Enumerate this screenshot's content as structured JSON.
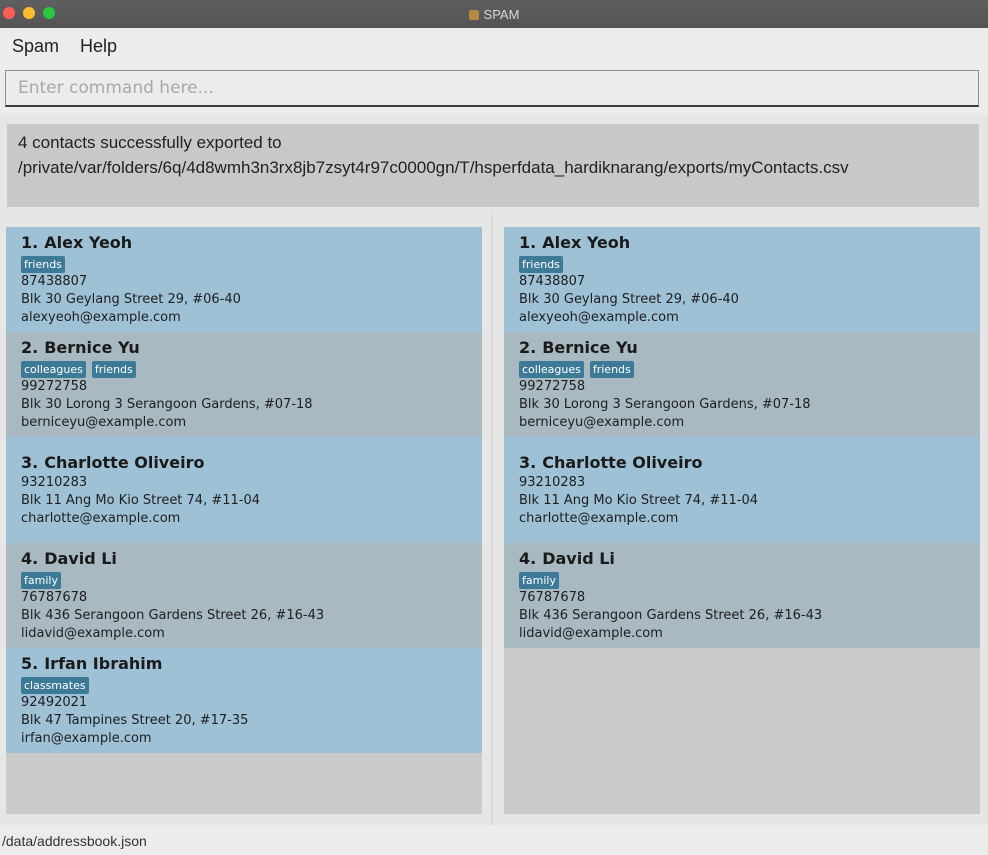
{
  "window": {
    "title": "SPAM"
  },
  "menu": {
    "spam": "Spam",
    "help": "Help"
  },
  "command": {
    "placeholder": "Enter command here...",
    "value": ""
  },
  "result": {
    "line1": "4 contacts successfully exported to",
    "line2": "/private/var/folders/6q/4d8wmh3n3rx8jb7zsyt4r97c0000gn/T/hsperfdata_hardiknarang/exports/myContacts.csv"
  },
  "left_list": [
    {
      "index": "1.",
      "name": "Alex Yeoh",
      "tags": [
        "friends"
      ],
      "phone": "87438807",
      "address": "Blk 30 Geylang Street 29, #06-40",
      "email": "alexyeoh@example.com"
    },
    {
      "index": "2.",
      "name": "Bernice Yu",
      "tags": [
        "colleagues",
        "friends"
      ],
      "phone": "99272758",
      "address": "Blk 30 Lorong 3 Serangoon Gardens, #07-18",
      "email": "berniceyu@example.com"
    },
    {
      "index": "3.",
      "name": "Charlotte Oliveiro",
      "tags": [],
      "phone": "93210283",
      "address": "Blk 11 Ang Mo Kio Street 74, #11-04",
      "email": "charlotte@example.com"
    },
    {
      "index": "4.",
      "name": "David Li",
      "tags": [
        "family"
      ],
      "phone": "76787678",
      "address": "Blk 436 Serangoon Gardens Street 26, #16-43",
      "email": "lidavid@example.com"
    },
    {
      "index": "5.",
      "name": "Irfan Ibrahim",
      "tags": [
        "classmates"
      ],
      "phone": "92492021",
      "address": "Blk 47 Tampines Street 20, #17-35",
      "email": "irfan@example.com"
    }
  ],
  "right_list": [
    {
      "index": "1.",
      "name": "Alex Yeoh",
      "tags": [
        "friends"
      ],
      "phone": "87438807",
      "address": "Blk 30 Geylang Street 29, #06-40",
      "email": "alexyeoh@example.com"
    },
    {
      "index": "2.",
      "name": "Bernice Yu",
      "tags": [
        "colleagues",
        "friends"
      ],
      "phone": "99272758",
      "address": "Blk 30 Lorong 3 Serangoon Gardens, #07-18",
      "email": "berniceyu@example.com"
    },
    {
      "index": "3.",
      "name": "Charlotte Oliveiro",
      "tags": [],
      "phone": "93210283",
      "address": "Blk 11 Ang Mo Kio Street 74, #11-04",
      "email": "charlotte@example.com"
    },
    {
      "index": "4.",
      "name": "David Li",
      "tags": [
        "family"
      ],
      "phone": "76787678",
      "address": "Blk 436 Serangoon Gardens Street 26, #16-43",
      "email": "lidavid@example.com"
    }
  ],
  "status": {
    "path": "/data/addressbook.json"
  },
  "colors": {
    "card_odd": "#9fc1d6",
    "card_even": "#a8b9c2",
    "tag": "#3d7a98",
    "result_bg": "#c8c8c8"
  }
}
